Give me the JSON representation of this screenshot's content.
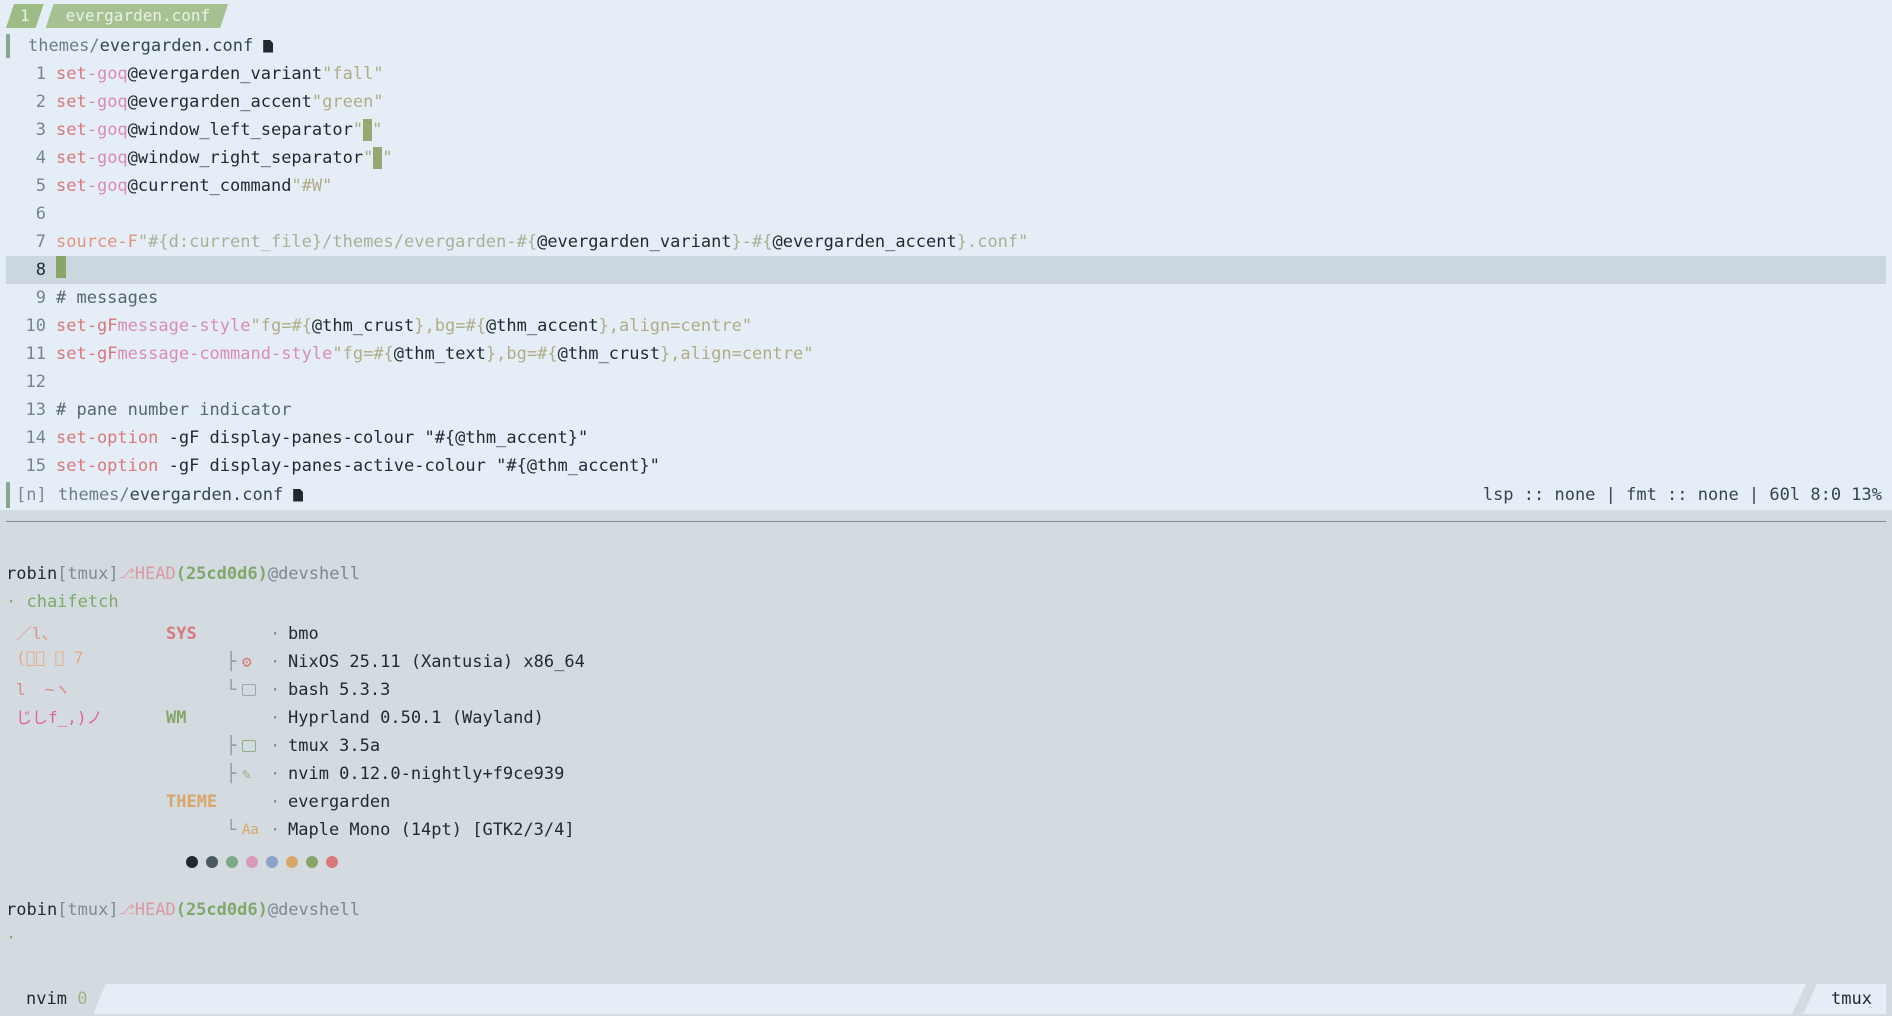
{
  "tabbar": {
    "number": "1",
    "filename": "evergarden.conf"
  },
  "winbar": {
    "dir": "themes/",
    "file": "evergarden.conf"
  },
  "code": {
    "l1": {
      "n": "1",
      "kw": "set",
      "flag": "-goq",
      "name": "@evergarden_variant",
      "val": "\"fall\""
    },
    "l2": {
      "n": "2",
      "kw": "set",
      "flag": "-goq",
      "name": "@evergarden_accent",
      "val": "\"green\""
    },
    "l3": {
      "n": "3",
      "kw": "set",
      "flag": "-goq",
      "name": "@window_left_separator"
    },
    "l4": {
      "n": "4",
      "kw": "set",
      "flag": "-goq",
      "name": "@window_right_separator"
    },
    "l5": {
      "n": "5",
      "kw": "set",
      "flag": "-goq",
      "name": "@current_command",
      "val": "\"#W\""
    },
    "l6": {
      "n": "6"
    },
    "l7": {
      "n": "7",
      "kw": "source",
      "flag": "-F",
      "p1": "\"#{d:current_file}/themes/evergarden-#{",
      "v1": "@evergarden_variant",
      "p2": "}-#{",
      "v2": "@evergarden_accent",
      "p3": "}.conf\""
    },
    "l8": {
      "n": "8"
    },
    "l9": {
      "n": "9",
      "comment": "# messages"
    },
    "l10": {
      "n": "10",
      "kw": "set",
      "flag": "-gF",
      "opt": "message-style",
      "p1": "\"fg=#{",
      "v1": "@thm_crust",
      "p2": "},bg=#{",
      "v2": "@thm_accent",
      "p3": "},align=centre\""
    },
    "l11": {
      "n": "11",
      "kw": "set",
      "flag": "-gF",
      "opt": "message-command-style",
      "p1": "\"fg=#{",
      "v1": "@thm_text",
      "p2": "},bg=#{",
      "v2": "@thm_crust",
      "p3": "},align=centre\""
    },
    "l12": {
      "n": "12"
    },
    "l13": {
      "n": "13",
      "comment": "# pane number indicator"
    },
    "l14": {
      "n": "14",
      "kw": "set-option",
      "rest": " -gF display-panes-colour \"#{@thm_accent}\""
    },
    "l15": {
      "n": "15",
      "kw": "set-option",
      "rest": " -gF display-panes-active-colour \"#{@thm_accent}\""
    }
  },
  "statusline": {
    "mode": "[n]",
    "dir": "themes/",
    "file": "evergarden.conf",
    "right": "lsp :: none | fmt :: none | 60l 8:0 13%"
  },
  "prompt": {
    "user": "robin",
    "tmux": "[tmux]",
    "head": "HEAD",
    "hash": "(25cd0d6)",
    "host": "@devshell",
    "cmd": "· chaifetch",
    "cmd2": "·"
  },
  "fetch": {
    "ascii": [
      "／l、",
      "(ﾟ､ ｡ 7",
      "l  ~ヽ",
      "じしf_,)ノ"
    ],
    "sys_label": "SYS",
    "wm_label": "WM",
    "theme_label": "THEME",
    "host": "bmo",
    "os": "NixOS 25.11 (Xantusia) x86_64",
    "shell": "bash 5.3.3",
    "wm": "Hyprland 0.50.1 (Wayland)",
    "mux": "tmux 3.5a",
    "editor": "nvim 0.12.0-nightly+f9ce939",
    "theme": "evergarden",
    "font": "Maple Mono (14pt) [GTK2/3/4]",
    "font_icon": "Aa",
    "palette": [
      "#1f2a30",
      "#4b5a62",
      "#7fa88a",
      "#d99ab8",
      "#8da3c7",
      "#d9a66a",
      "#89a56a",
      "#d9777b"
    ]
  },
  "tmux": {
    "session": "nvim",
    "index": "0",
    "right": "tmux"
  }
}
